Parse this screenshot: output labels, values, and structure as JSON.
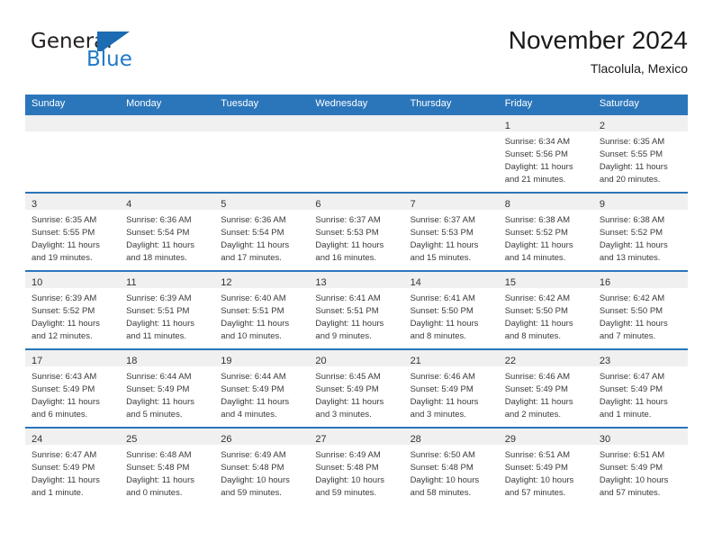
{
  "brand": {
    "word_general": "General",
    "word_blue": "Blue",
    "logo_icon": "triangle-flag-logo",
    "accent_color": "#1b6cb3"
  },
  "header": {
    "title": "November 2024",
    "subtitle": "Tlacolula, Mexico"
  },
  "theme": {
    "header_blue": "#2b76bb",
    "daynum_band": "#f0f0f0",
    "text": "#3a3a3a"
  },
  "weekday_headers": [
    "Sunday",
    "Monday",
    "Tuesday",
    "Wednesday",
    "Thursday",
    "Friday",
    "Saturday"
  ],
  "weeks": [
    [
      {
        "day": "",
        "sunrise": "",
        "sunset": "",
        "daylight1": "",
        "daylight2": ""
      },
      {
        "day": "",
        "sunrise": "",
        "sunset": "",
        "daylight1": "",
        "daylight2": ""
      },
      {
        "day": "",
        "sunrise": "",
        "sunset": "",
        "daylight1": "",
        "daylight2": ""
      },
      {
        "day": "",
        "sunrise": "",
        "sunset": "",
        "daylight1": "",
        "daylight2": ""
      },
      {
        "day": "",
        "sunrise": "",
        "sunset": "",
        "daylight1": "",
        "daylight2": ""
      },
      {
        "day": "1",
        "sunrise": "Sunrise: 6:34 AM",
        "sunset": "Sunset: 5:56 PM",
        "daylight1": "Daylight: 11 hours",
        "daylight2": "and 21 minutes."
      },
      {
        "day": "2",
        "sunrise": "Sunrise: 6:35 AM",
        "sunset": "Sunset: 5:55 PM",
        "daylight1": "Daylight: 11 hours",
        "daylight2": "and 20 minutes."
      }
    ],
    [
      {
        "day": "3",
        "sunrise": "Sunrise: 6:35 AM",
        "sunset": "Sunset: 5:55 PM",
        "daylight1": "Daylight: 11 hours",
        "daylight2": "and 19 minutes."
      },
      {
        "day": "4",
        "sunrise": "Sunrise: 6:36 AM",
        "sunset": "Sunset: 5:54 PM",
        "daylight1": "Daylight: 11 hours",
        "daylight2": "and 18 minutes."
      },
      {
        "day": "5",
        "sunrise": "Sunrise: 6:36 AM",
        "sunset": "Sunset: 5:54 PM",
        "daylight1": "Daylight: 11 hours",
        "daylight2": "and 17 minutes."
      },
      {
        "day": "6",
        "sunrise": "Sunrise: 6:37 AM",
        "sunset": "Sunset: 5:53 PM",
        "daylight1": "Daylight: 11 hours",
        "daylight2": "and 16 minutes."
      },
      {
        "day": "7",
        "sunrise": "Sunrise: 6:37 AM",
        "sunset": "Sunset: 5:53 PM",
        "daylight1": "Daylight: 11 hours",
        "daylight2": "and 15 minutes."
      },
      {
        "day": "8",
        "sunrise": "Sunrise: 6:38 AM",
        "sunset": "Sunset: 5:52 PM",
        "daylight1": "Daylight: 11 hours",
        "daylight2": "and 14 minutes."
      },
      {
        "day": "9",
        "sunrise": "Sunrise: 6:38 AM",
        "sunset": "Sunset: 5:52 PM",
        "daylight1": "Daylight: 11 hours",
        "daylight2": "and 13 minutes."
      }
    ],
    [
      {
        "day": "10",
        "sunrise": "Sunrise: 6:39 AM",
        "sunset": "Sunset: 5:52 PM",
        "daylight1": "Daylight: 11 hours",
        "daylight2": "and 12 minutes."
      },
      {
        "day": "11",
        "sunrise": "Sunrise: 6:39 AM",
        "sunset": "Sunset: 5:51 PM",
        "daylight1": "Daylight: 11 hours",
        "daylight2": "and 11 minutes."
      },
      {
        "day": "12",
        "sunrise": "Sunrise: 6:40 AM",
        "sunset": "Sunset: 5:51 PM",
        "daylight1": "Daylight: 11 hours",
        "daylight2": "and 10 minutes."
      },
      {
        "day": "13",
        "sunrise": "Sunrise: 6:41 AM",
        "sunset": "Sunset: 5:51 PM",
        "daylight1": "Daylight: 11 hours",
        "daylight2": "and 9 minutes."
      },
      {
        "day": "14",
        "sunrise": "Sunrise: 6:41 AM",
        "sunset": "Sunset: 5:50 PM",
        "daylight1": "Daylight: 11 hours",
        "daylight2": "and 8 minutes."
      },
      {
        "day": "15",
        "sunrise": "Sunrise: 6:42 AM",
        "sunset": "Sunset: 5:50 PM",
        "daylight1": "Daylight: 11 hours",
        "daylight2": "and 8 minutes."
      },
      {
        "day": "16",
        "sunrise": "Sunrise: 6:42 AM",
        "sunset": "Sunset: 5:50 PM",
        "daylight1": "Daylight: 11 hours",
        "daylight2": "and 7 minutes."
      }
    ],
    [
      {
        "day": "17",
        "sunrise": "Sunrise: 6:43 AM",
        "sunset": "Sunset: 5:49 PM",
        "daylight1": "Daylight: 11 hours",
        "daylight2": "and 6 minutes."
      },
      {
        "day": "18",
        "sunrise": "Sunrise: 6:44 AM",
        "sunset": "Sunset: 5:49 PM",
        "daylight1": "Daylight: 11 hours",
        "daylight2": "and 5 minutes."
      },
      {
        "day": "19",
        "sunrise": "Sunrise: 6:44 AM",
        "sunset": "Sunset: 5:49 PM",
        "daylight1": "Daylight: 11 hours",
        "daylight2": "and 4 minutes."
      },
      {
        "day": "20",
        "sunrise": "Sunrise: 6:45 AM",
        "sunset": "Sunset: 5:49 PM",
        "daylight1": "Daylight: 11 hours",
        "daylight2": "and 3 minutes."
      },
      {
        "day": "21",
        "sunrise": "Sunrise: 6:46 AM",
        "sunset": "Sunset: 5:49 PM",
        "daylight1": "Daylight: 11 hours",
        "daylight2": "and 3 minutes."
      },
      {
        "day": "22",
        "sunrise": "Sunrise: 6:46 AM",
        "sunset": "Sunset: 5:49 PM",
        "daylight1": "Daylight: 11 hours",
        "daylight2": "and 2 minutes."
      },
      {
        "day": "23",
        "sunrise": "Sunrise: 6:47 AM",
        "sunset": "Sunset: 5:49 PM",
        "daylight1": "Daylight: 11 hours",
        "daylight2": "and 1 minute."
      }
    ],
    [
      {
        "day": "24",
        "sunrise": "Sunrise: 6:47 AM",
        "sunset": "Sunset: 5:49 PM",
        "daylight1": "Daylight: 11 hours",
        "daylight2": "and 1 minute."
      },
      {
        "day": "25",
        "sunrise": "Sunrise: 6:48 AM",
        "sunset": "Sunset: 5:48 PM",
        "daylight1": "Daylight: 11 hours",
        "daylight2": "and 0 minutes."
      },
      {
        "day": "26",
        "sunrise": "Sunrise: 6:49 AM",
        "sunset": "Sunset: 5:48 PM",
        "daylight1": "Daylight: 10 hours",
        "daylight2": "and 59 minutes."
      },
      {
        "day": "27",
        "sunrise": "Sunrise: 6:49 AM",
        "sunset": "Sunset: 5:48 PM",
        "daylight1": "Daylight: 10 hours",
        "daylight2": "and 59 minutes."
      },
      {
        "day": "28",
        "sunrise": "Sunrise: 6:50 AM",
        "sunset": "Sunset: 5:48 PM",
        "daylight1": "Daylight: 10 hours",
        "daylight2": "and 58 minutes."
      },
      {
        "day": "29",
        "sunrise": "Sunrise: 6:51 AM",
        "sunset": "Sunset: 5:49 PM",
        "daylight1": "Daylight: 10 hours",
        "daylight2": "and 57 minutes."
      },
      {
        "day": "30",
        "sunrise": "Sunrise: 6:51 AM",
        "sunset": "Sunset: 5:49 PM",
        "daylight1": "Daylight: 10 hours",
        "daylight2": "and 57 minutes."
      }
    ]
  ]
}
